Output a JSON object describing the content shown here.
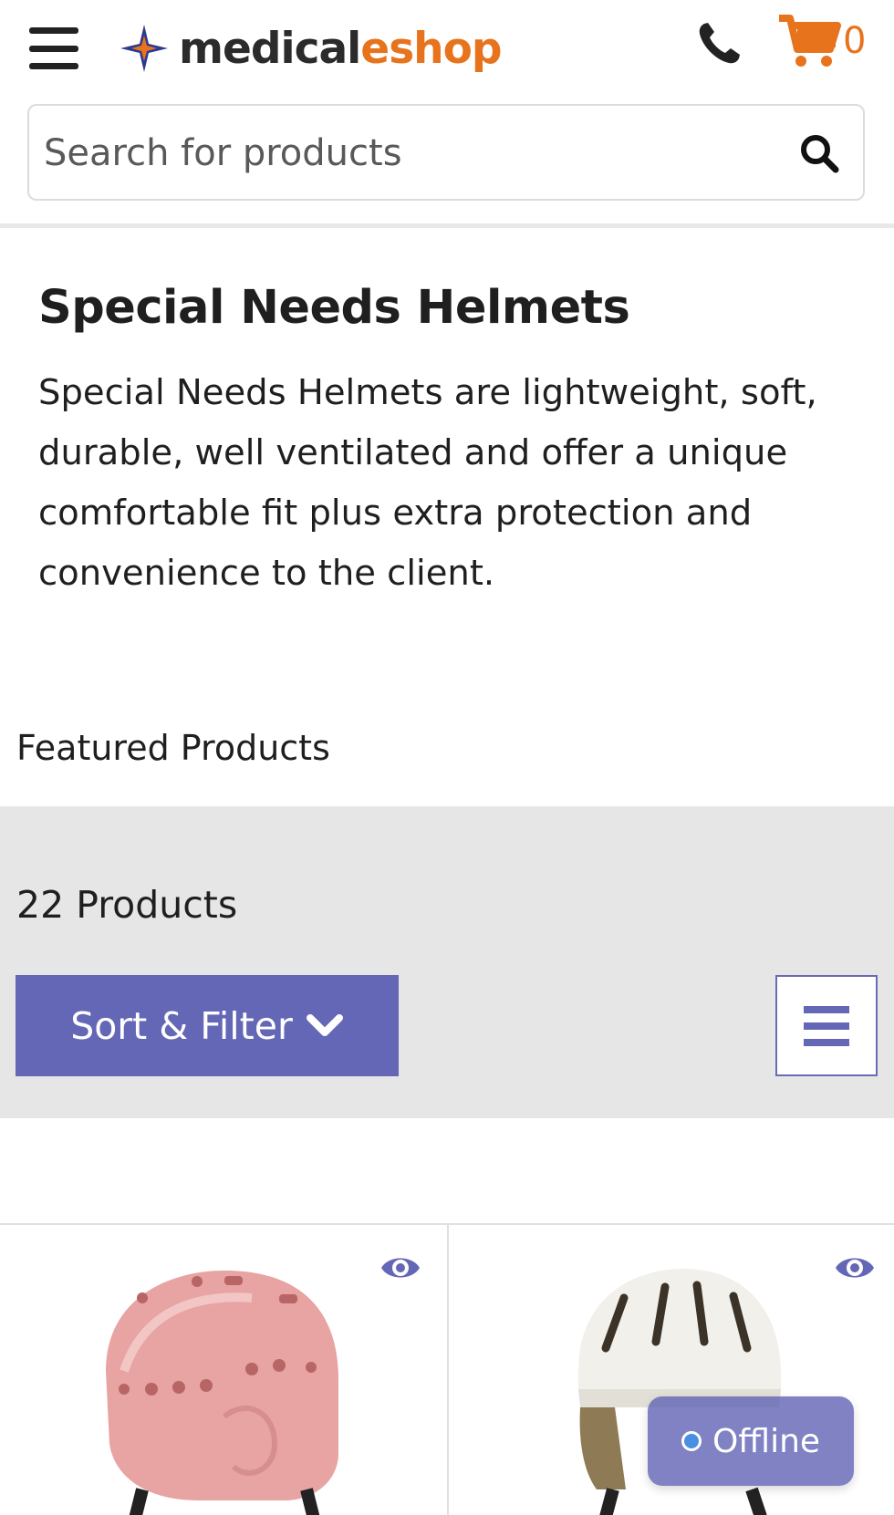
{
  "brand": {
    "logo_text_main": "medical",
    "logo_text_e": "e",
    "logo_text_accent": "shop",
    "accent_color": "#e8731d",
    "primary_color": "#6466b6"
  },
  "header": {
    "cart_count": "0"
  },
  "search": {
    "placeholder": "Search for products"
  },
  "category": {
    "title": "Special Needs Helmets",
    "description": "Special Needs Helmets are lightweight, soft, durable, well ventilated and offer a unique comfortable fit plus extra protection and convenience to the client."
  },
  "featured": {
    "label": "Featured Products"
  },
  "toolbar": {
    "count": "22 Products",
    "sort_filter_label": "Sort & Filter"
  },
  "chat": {
    "status": "Offline"
  },
  "icons": [
    "menu-icon",
    "logo-icon",
    "phone-icon",
    "cart-icon",
    "search-icon",
    "chevron-down-icon",
    "list-view-icon",
    "eye-icon",
    "status-dot-icon"
  ]
}
